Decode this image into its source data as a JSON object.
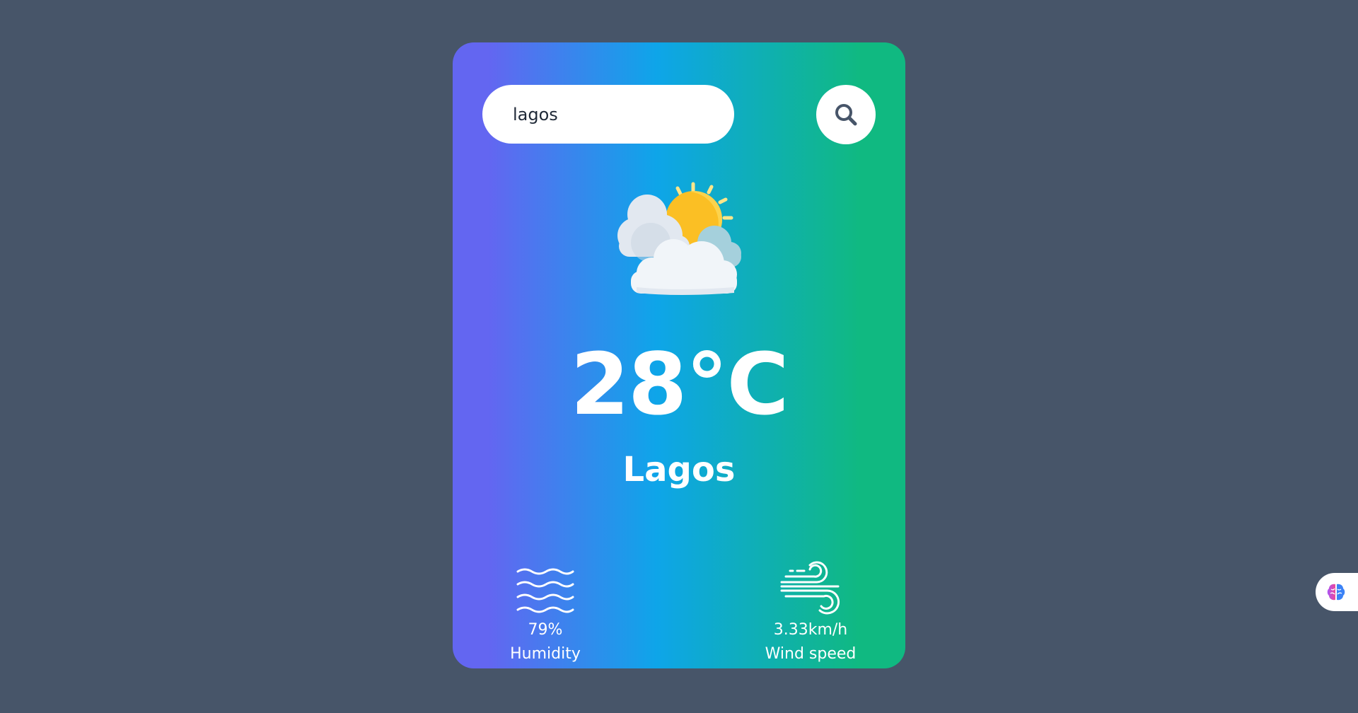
{
  "search": {
    "value": "lagos",
    "icon": "search-icon"
  },
  "weather": {
    "icon": "partly-cloudy-icon",
    "temperature": "28°C",
    "city": "Lagos"
  },
  "stats": {
    "humidity": {
      "icon": "humidity-waves-icon",
      "value": "79%",
      "label": "Humidity"
    },
    "wind": {
      "icon": "wind-icon",
      "value": "3.33km/h",
      "label": "Wind speed"
    }
  },
  "side_widget": {
    "icon": "brain-icon"
  },
  "colors": {
    "background": "#475569",
    "gradient_start": "#6366f1",
    "gradient_mid": "#0ea5e9",
    "gradient_end": "#10b981"
  }
}
